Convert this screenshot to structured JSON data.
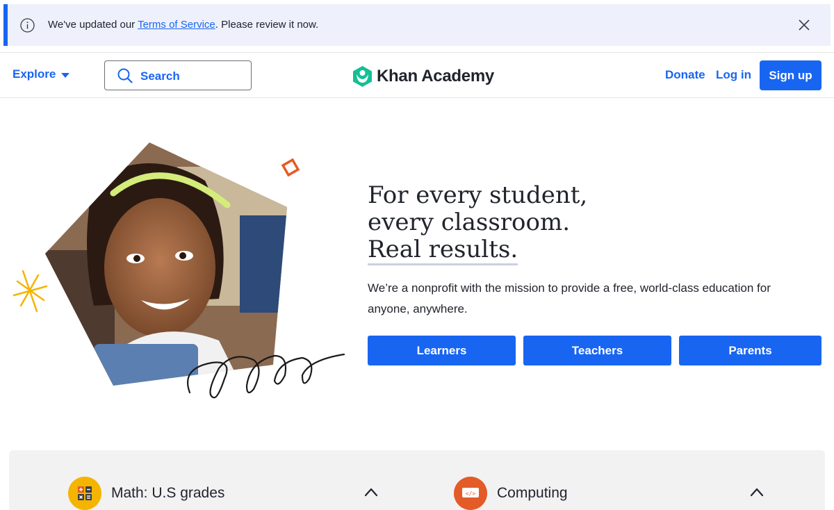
{
  "banner": {
    "prefix": "We've updated our ",
    "link": "Terms of Service",
    "suffix": ". Please review it now."
  },
  "header": {
    "explore_label": "Explore",
    "search_placeholder": "Search",
    "logo_text": "Khan Academy",
    "donate_label": "Donate",
    "login_label": "Log in",
    "signup_label": "Sign up"
  },
  "hero": {
    "headline_line1": "For every student,",
    "headline_line2": "every classroom.",
    "headline_line3": "Real results.",
    "subtext": "We’re a nonprofit with the mission to provide a free, world-class education for anyone, anywhere.",
    "buttons": [
      {
        "label": "Learners"
      },
      {
        "label": "Teachers"
      },
      {
        "label": "Parents"
      }
    ]
  },
  "subjects": [
    {
      "label": "Math: U.S grades",
      "icon": "calculator-icon",
      "color": "#f4b400"
    },
    {
      "label": "Computing",
      "icon": "code-icon",
      "color": "#e35b27"
    }
  ],
  "colors": {
    "accent": "#1865f2",
    "banner_bg": "#eef1fb",
    "text": "#21242c",
    "logo_green": "#14bf96"
  }
}
